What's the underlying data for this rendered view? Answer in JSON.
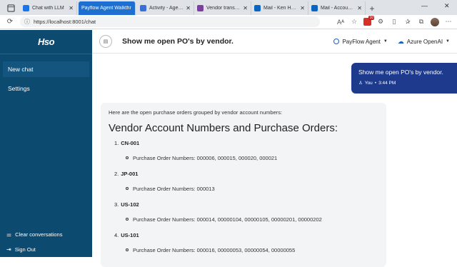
{
  "browser": {
    "tabs": [
      {
        "title": "Chat with LLM",
        "color": "#1a73e8"
      },
      {
        "title": "Payflow Agent Walkthr",
        "color": "#ffffff",
        "active": true
      },
      {
        "title": "Activity - Agent Mic",
        "color": "#3b6fd6"
      },
      {
        "title": "Vendor transactions",
        "color": "#7b3fa0"
      },
      {
        "title": "Mail - Ken Heiman",
        "color": "#0a64c2"
      },
      {
        "title": "Mail - Accounts Pay",
        "color": "#0a64c2"
      }
    ],
    "url": "https://localhost:8001/chat",
    "badge_count": "10"
  },
  "sidebar": {
    "logo": "Hso",
    "items": [
      {
        "label": "New chat"
      },
      {
        "label": "Settings"
      }
    ],
    "bottom": [
      {
        "label": "Clear conversations",
        "icon": "sliders-icon"
      },
      {
        "label": "Sign Out",
        "icon": "sign-out-icon"
      }
    ]
  },
  "header": {
    "title": "Show me open PO's by vendor.",
    "agent_label": "PayFlow Agent",
    "provider_label": "Azure OpenAI"
  },
  "user_message": {
    "text": "Show me open PO's by vendor.",
    "author": "You",
    "time": "3:44 PM"
  },
  "bot_message": {
    "intro": "Here are the open purchase orders grouped by vendor account numbers:",
    "heading": "Vendor Account Numbers and Purchase Orders:",
    "vendors": [
      {
        "num": "1.",
        "name": "CN-001",
        "po": "Purchase Order Numbers: 000006, 000015, 000020, 000021"
      },
      {
        "num": "2.",
        "name": "JP-001",
        "po": "Purchase Order Numbers: 000013"
      },
      {
        "num": "3.",
        "name": "US-102",
        "po": "Purchase Order Numbers: 000014, 00000104, 00000105, 00000201, 00000202"
      },
      {
        "num": "4.",
        "name": "US-101",
        "po": "Purchase Order Numbers: 000016, 00000053, 00000054, 00000055"
      }
    ]
  },
  "colors": {
    "sidebar": "#0d4a70",
    "user_bubble": "#1d3a8c",
    "active_tab": "#1f6fd0"
  }
}
